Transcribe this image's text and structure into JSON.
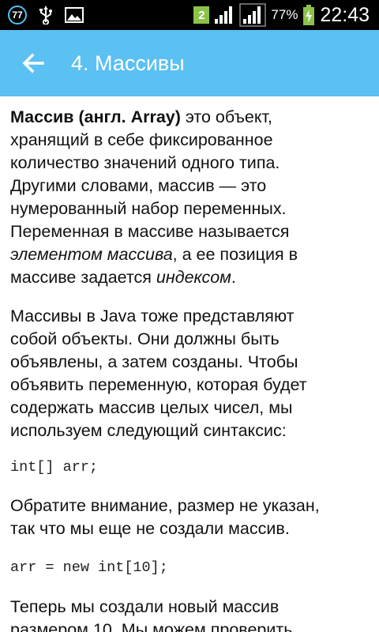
{
  "status_bar": {
    "notification_badge": "77",
    "sim_badge": "2",
    "battery_percent": "77%",
    "time": "22:43"
  },
  "app_bar": {
    "title": "4. Массивы"
  },
  "content": {
    "p1": {
      "bold_term": "Массив (англ. Array)",
      "line1_rest": " это объект,",
      "line2": "хранящий в себе фиксированное",
      "line3": "количество значений одного типа.",
      "line4": "Другими словами, массив — это",
      "line5": "нумерованный набор переменных.",
      "line6": "Переменная в массиве называется",
      "italic_element": "элементом массива",
      "line7_rest": ", а ее позиция в",
      "line8_start": "массиве задается ",
      "italic_index": "индексом",
      "line8_end": "."
    },
    "p2": {
      "line1": "Массивы в Java тоже представляют",
      "line2": "собой объекты. Они должны быть",
      "line3": "объявлены, а затем созданы. Чтобы",
      "line4": "объявить переменную, которая будет",
      "line5": "содержать массив целых чисел, мы",
      "line6": "используем следующий синтаксис:"
    },
    "code1": "int[] arr;",
    "p3": {
      "line1": "Обратите внимание, размер не указан,",
      "line2": "так что мы еще не создали массив."
    },
    "code2": "arr = new int[10];",
    "p4": {
      "line1": "Теперь мы создали новый массив",
      "line2": "размером 10. Мы можем проверить"
    }
  },
  "colors": {
    "status_bar_bg": "#000000",
    "app_bar_bg": "#5bc0f2",
    "accent_ring": "#4fc3f7",
    "sim_badge": "#8bc34a"
  }
}
